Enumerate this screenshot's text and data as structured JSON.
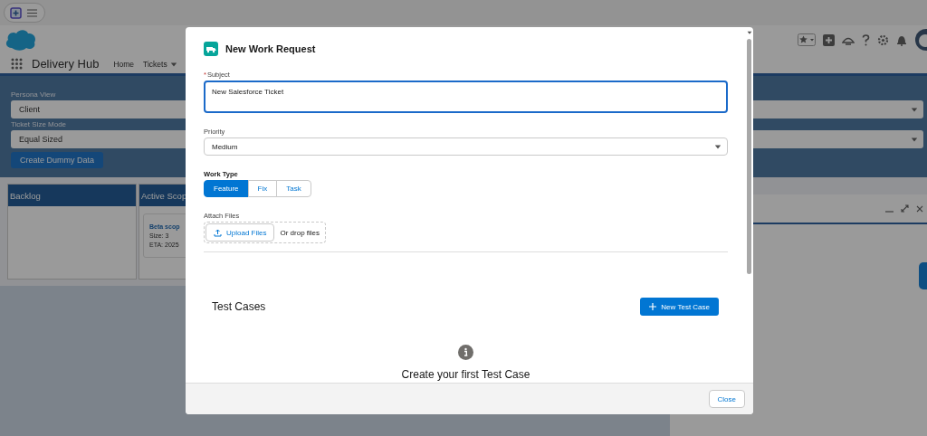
{
  "header": {
    "app_name": "Delivery Hub",
    "nav": [
      {
        "label": "Home",
        "dropdown": false
      },
      {
        "label": "Tickets",
        "dropdown": true
      }
    ]
  },
  "filters": [
    {
      "label": "Persona View",
      "value": "Client"
    },
    {
      "label": "Ticket Size Mode",
      "value": "Equal Sized"
    }
  ],
  "filter_button": "Create Dummy Data",
  "board": {
    "columns": [
      {
        "title": "Backlog"
      },
      {
        "title": "Active Scop",
        "cards": [
          {
            "title": "Beta scop",
            "lines": [
              "Size: 3",
              "ETA: 2025"
            ]
          }
        ]
      }
    ]
  },
  "modal": {
    "title": "New Work Request",
    "subject": {
      "label": "Subject",
      "required_mark": "*",
      "value": "New Salesforce Ticket"
    },
    "priority": {
      "label": "Priority",
      "value": "Medium"
    },
    "work_type": {
      "label": "Work Type",
      "options": [
        {
          "label": "Feature",
          "selected": true
        },
        {
          "label": "Fix",
          "selected": false
        },
        {
          "label": "Task",
          "selected": false
        }
      ]
    },
    "attach": {
      "label": "Attach Files",
      "button": "Upload Files",
      "drop_text": "Or drop files"
    },
    "test_cases": {
      "title": "Test Cases",
      "button": "New Test Case",
      "empty_message": "Create your first Test Case"
    },
    "footer_button": "Close"
  }
}
